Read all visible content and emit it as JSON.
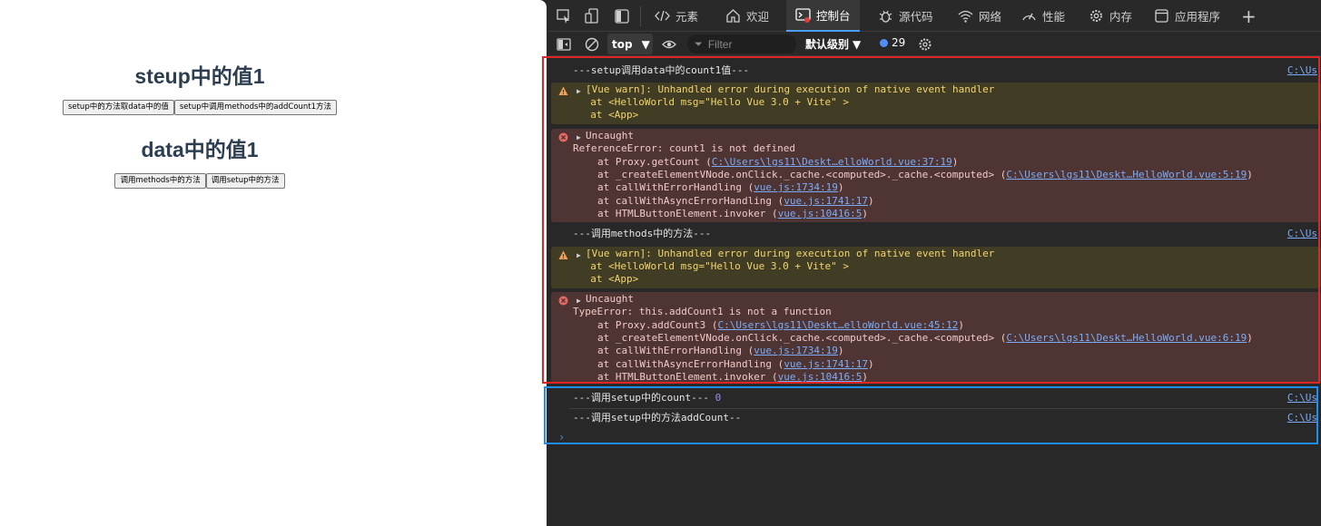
{
  "page": {
    "heading1": "steup中的值1",
    "buttons_row1": [
      "setup中的方法取data中的值",
      "setup中调用methods中的addCount1方法"
    ],
    "heading2": "data中的值1",
    "buttons_row2": [
      "调用methods中的方法",
      "调用setup中的方法"
    ]
  },
  "devtools": {
    "tabs": [
      {
        "label": "元素",
        "icon": "code-icon"
      },
      {
        "label": "欢迎",
        "icon": "home-icon"
      },
      {
        "label": "控制台",
        "icon": "console-icon",
        "active": true
      },
      {
        "label": "源代码",
        "icon": "bug-icon"
      },
      {
        "label": "网络",
        "icon": "wifi-icon"
      },
      {
        "label": "性能",
        "icon": "gauge-icon"
      },
      {
        "label": "内存",
        "icon": "gear-icon"
      },
      {
        "label": "应用程序",
        "icon": "window-icon"
      }
    ],
    "toolbar": {
      "context": "top",
      "filter_placeholder": "Filter",
      "levels": "默认级别",
      "issues_count": "29"
    },
    "console": {
      "src_link": "C:\\Us",
      "log1": "---setup调用data中的count1值---",
      "warn1": {
        "line1": "[Vue warn]: Unhandled error during execution of native event handler",
        "line2": "  at <HelloWorld msg=\"Hello Vue 3.0 + Vite\" >",
        "line3": "  at <App>"
      },
      "err1": {
        "title": "Uncaught",
        "message": "ReferenceError: count1 is not defined",
        "frames": [
          {
            "fn": "at Proxy.getCount (",
            "link": "C:\\Users\\lgs11\\Deskt…elloWorld.vue:37:19",
            "tail": ")"
          },
          {
            "fn": "at _createElementVNode.onClick._cache.<computed>._cache.<computed> (",
            "link": "C:\\Users\\lgs11\\Deskt…HelloWorld.vue:5:19",
            "tail": ")"
          },
          {
            "fn": "at callWithErrorHandling (",
            "link": "vue.js:1734:19",
            "tail": ")"
          },
          {
            "fn": "at callWithAsyncErrorHandling (",
            "link": "vue.js:1741:17",
            "tail": ")"
          },
          {
            "fn": "at HTMLButtonElement.invoker (",
            "link": "vue.js:10416:5",
            "tail": ")"
          }
        ]
      },
      "log2": "---调用methods中的方法---",
      "warn2": {
        "line1": "[Vue warn]: Unhandled error during execution of native event handler",
        "line2": "  at <HelloWorld msg=\"Hello Vue 3.0 + Vite\" >",
        "line3": "  at <App>"
      },
      "err2": {
        "title": "Uncaught",
        "message": "TypeError: this.addCount1 is not a function",
        "frames": [
          {
            "fn": "at Proxy.addCount3 (",
            "link": "C:\\Users\\lgs11\\Deskt…elloWorld.vue:45:12",
            "tail": ")"
          },
          {
            "fn": "at _createElementVNode.onClick._cache.<computed>._cache.<computed> (",
            "link": "C:\\Users\\lgs11\\Deskt…HelloWorld.vue:6:19",
            "tail": ")"
          },
          {
            "fn": "at callWithErrorHandling (",
            "link": "vue.js:1734:19",
            "tail": ")"
          },
          {
            "fn": "at callWithAsyncErrorHandling (",
            "link": "vue.js:1741:17",
            "tail": ")"
          },
          {
            "fn": "at HTMLButtonElement.invoker (",
            "link": "vue.js:10416:5",
            "tail": ")"
          }
        ]
      },
      "log3": "---调用setup中的count---",
      "log3_value": "0",
      "log4": "---调用setup中的方法addCount--"
    }
  }
}
